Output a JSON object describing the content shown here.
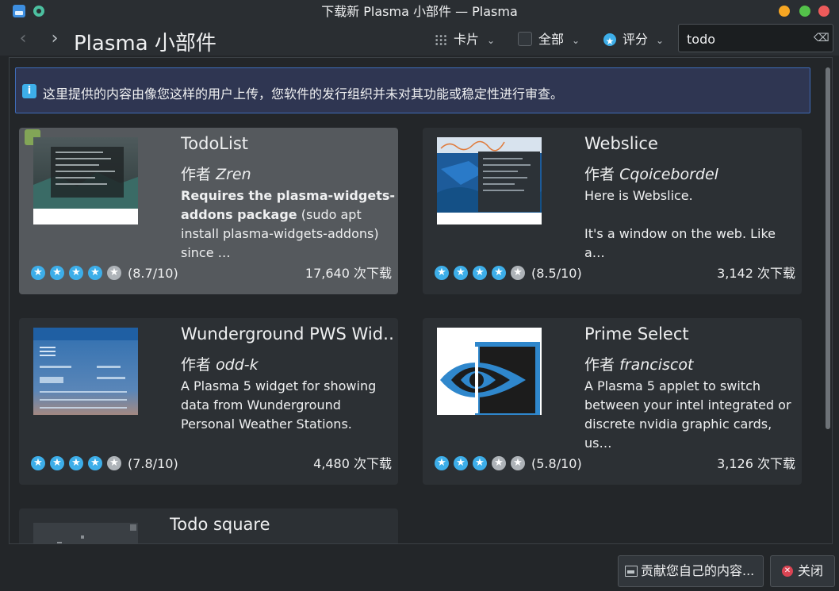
{
  "window": {
    "title": "下载新 Plasma 小部件 — Plasma"
  },
  "toolbar": {
    "page_title": "Plasma 小部件",
    "back_icon": "‹",
    "forward_icon": "›",
    "view_mode": "卡片",
    "filter": "全部",
    "sort": "评分",
    "search_value": "todo",
    "clear_icon": "⌫"
  },
  "notice": {
    "icon": "i",
    "text": "这里提供的内容由像您这样的用户上传，您软件的发行组织并未对其功能或稳定性进行审查。"
  },
  "items": [
    {
      "name": "TodoList",
      "author_prefix": "作者",
      "author": "Zren",
      "desc_bold": "Requires the plasma-widgets-addons package",
      "desc": " (sudo apt install plasma-widgets-addons) since …",
      "stars": 4,
      "rating": "(8.7/10)",
      "downloads": "17,640 次下载"
    },
    {
      "name": "Webslice",
      "author_prefix": "作者",
      "author": "Cqoicebordel",
      "desc_line1": "Here is Webslice.",
      "desc_line2": "It's a window on the web. Like a…",
      "stars": 4,
      "rating": "(8.5/10)",
      "downloads": "3,142 次下载"
    },
    {
      "name": "Wunderground PWS Wid…",
      "author_prefix": "作者",
      "author": "odd-k",
      "desc": "A Plasma 5 widget for showing data from Wunderground Personal Weather Stations.",
      "stars": 4,
      "rating": "(7.8/10)",
      "downloads": "4,480 次下载"
    },
    {
      "name": "Prime Select",
      "author_prefix": "作者",
      "author": "franciscot",
      "desc": "A Plasma 5 applet to switch between your intel integrated or discrete nvidia graphic cards, us…",
      "stars": 3,
      "rating": "(5.8/10)",
      "downloads": "3,126 次下载"
    },
    {
      "name": "Todo square"
    }
  ],
  "footer": {
    "contribute_label": "贡献您自己的内容...",
    "close_label": "关闭"
  },
  "colors": {
    "accent": "#3daee9",
    "background": "#232629",
    "card": "#2c3034",
    "notice_border": "#3f6bb8"
  }
}
